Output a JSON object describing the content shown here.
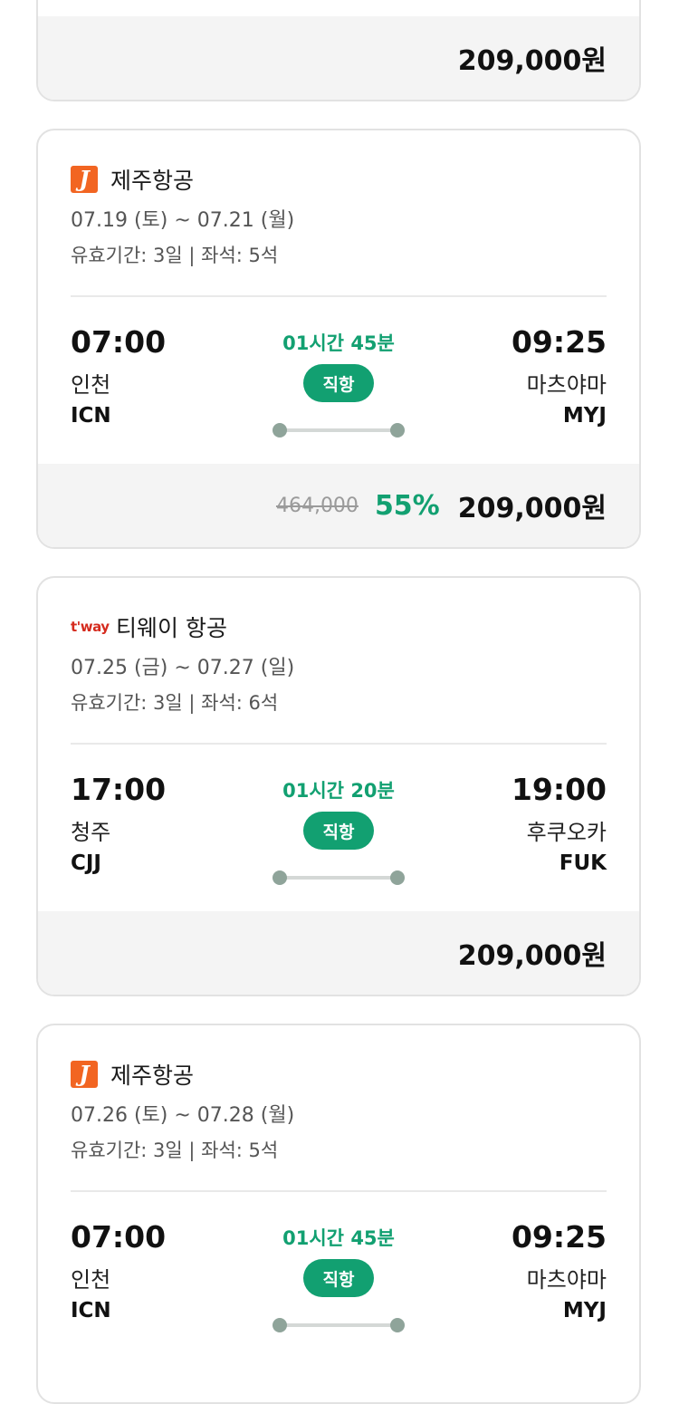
{
  "cards": [
    {
      "price": "209,000원"
    },
    {
      "airline": "제주항공",
      "logo": "J",
      "dates": "07.19 (토) ~ 07.21 (월)",
      "validity": "유효기간: 3일 | 좌석: 5석",
      "dep_time": "07:00",
      "dep_city": "인천",
      "dep_code": "ICN",
      "duration": "01시간 45분",
      "direct": "직항",
      "arr_time": "09:25",
      "arr_city": "마츠야마",
      "arr_code": "MYJ",
      "original_price": "464,000",
      "discount": "55%",
      "price": "209,000원"
    },
    {
      "airline": "티웨이 항공",
      "logo": "t'way",
      "dates": "07.25 (금) ~ 07.27 (일)",
      "validity": "유효기간: 3일 | 좌석: 6석",
      "dep_time": "17:00",
      "dep_city": "청주",
      "dep_code": "CJJ",
      "duration": "01시간 20분",
      "direct": "직항",
      "arr_time": "19:00",
      "arr_city": "후쿠오카",
      "arr_code": "FUK",
      "price": "209,000원"
    },
    {
      "airline": "제주항공",
      "logo": "J",
      "dates": "07.26 (토) ~ 07.28 (월)",
      "validity": "유효기간: 3일 | 좌석: 5석",
      "dep_time": "07:00",
      "dep_city": "인천",
      "dep_code": "ICN",
      "duration": "01시간 45분",
      "direct": "직항",
      "arr_time": "09:25",
      "arr_city": "마츠야마",
      "arr_code": "MYJ"
    }
  ],
  "colors": {
    "accent_green": "#12a071",
    "jeju_orange": "#f26522",
    "tway_red": "#d52b1e"
  }
}
